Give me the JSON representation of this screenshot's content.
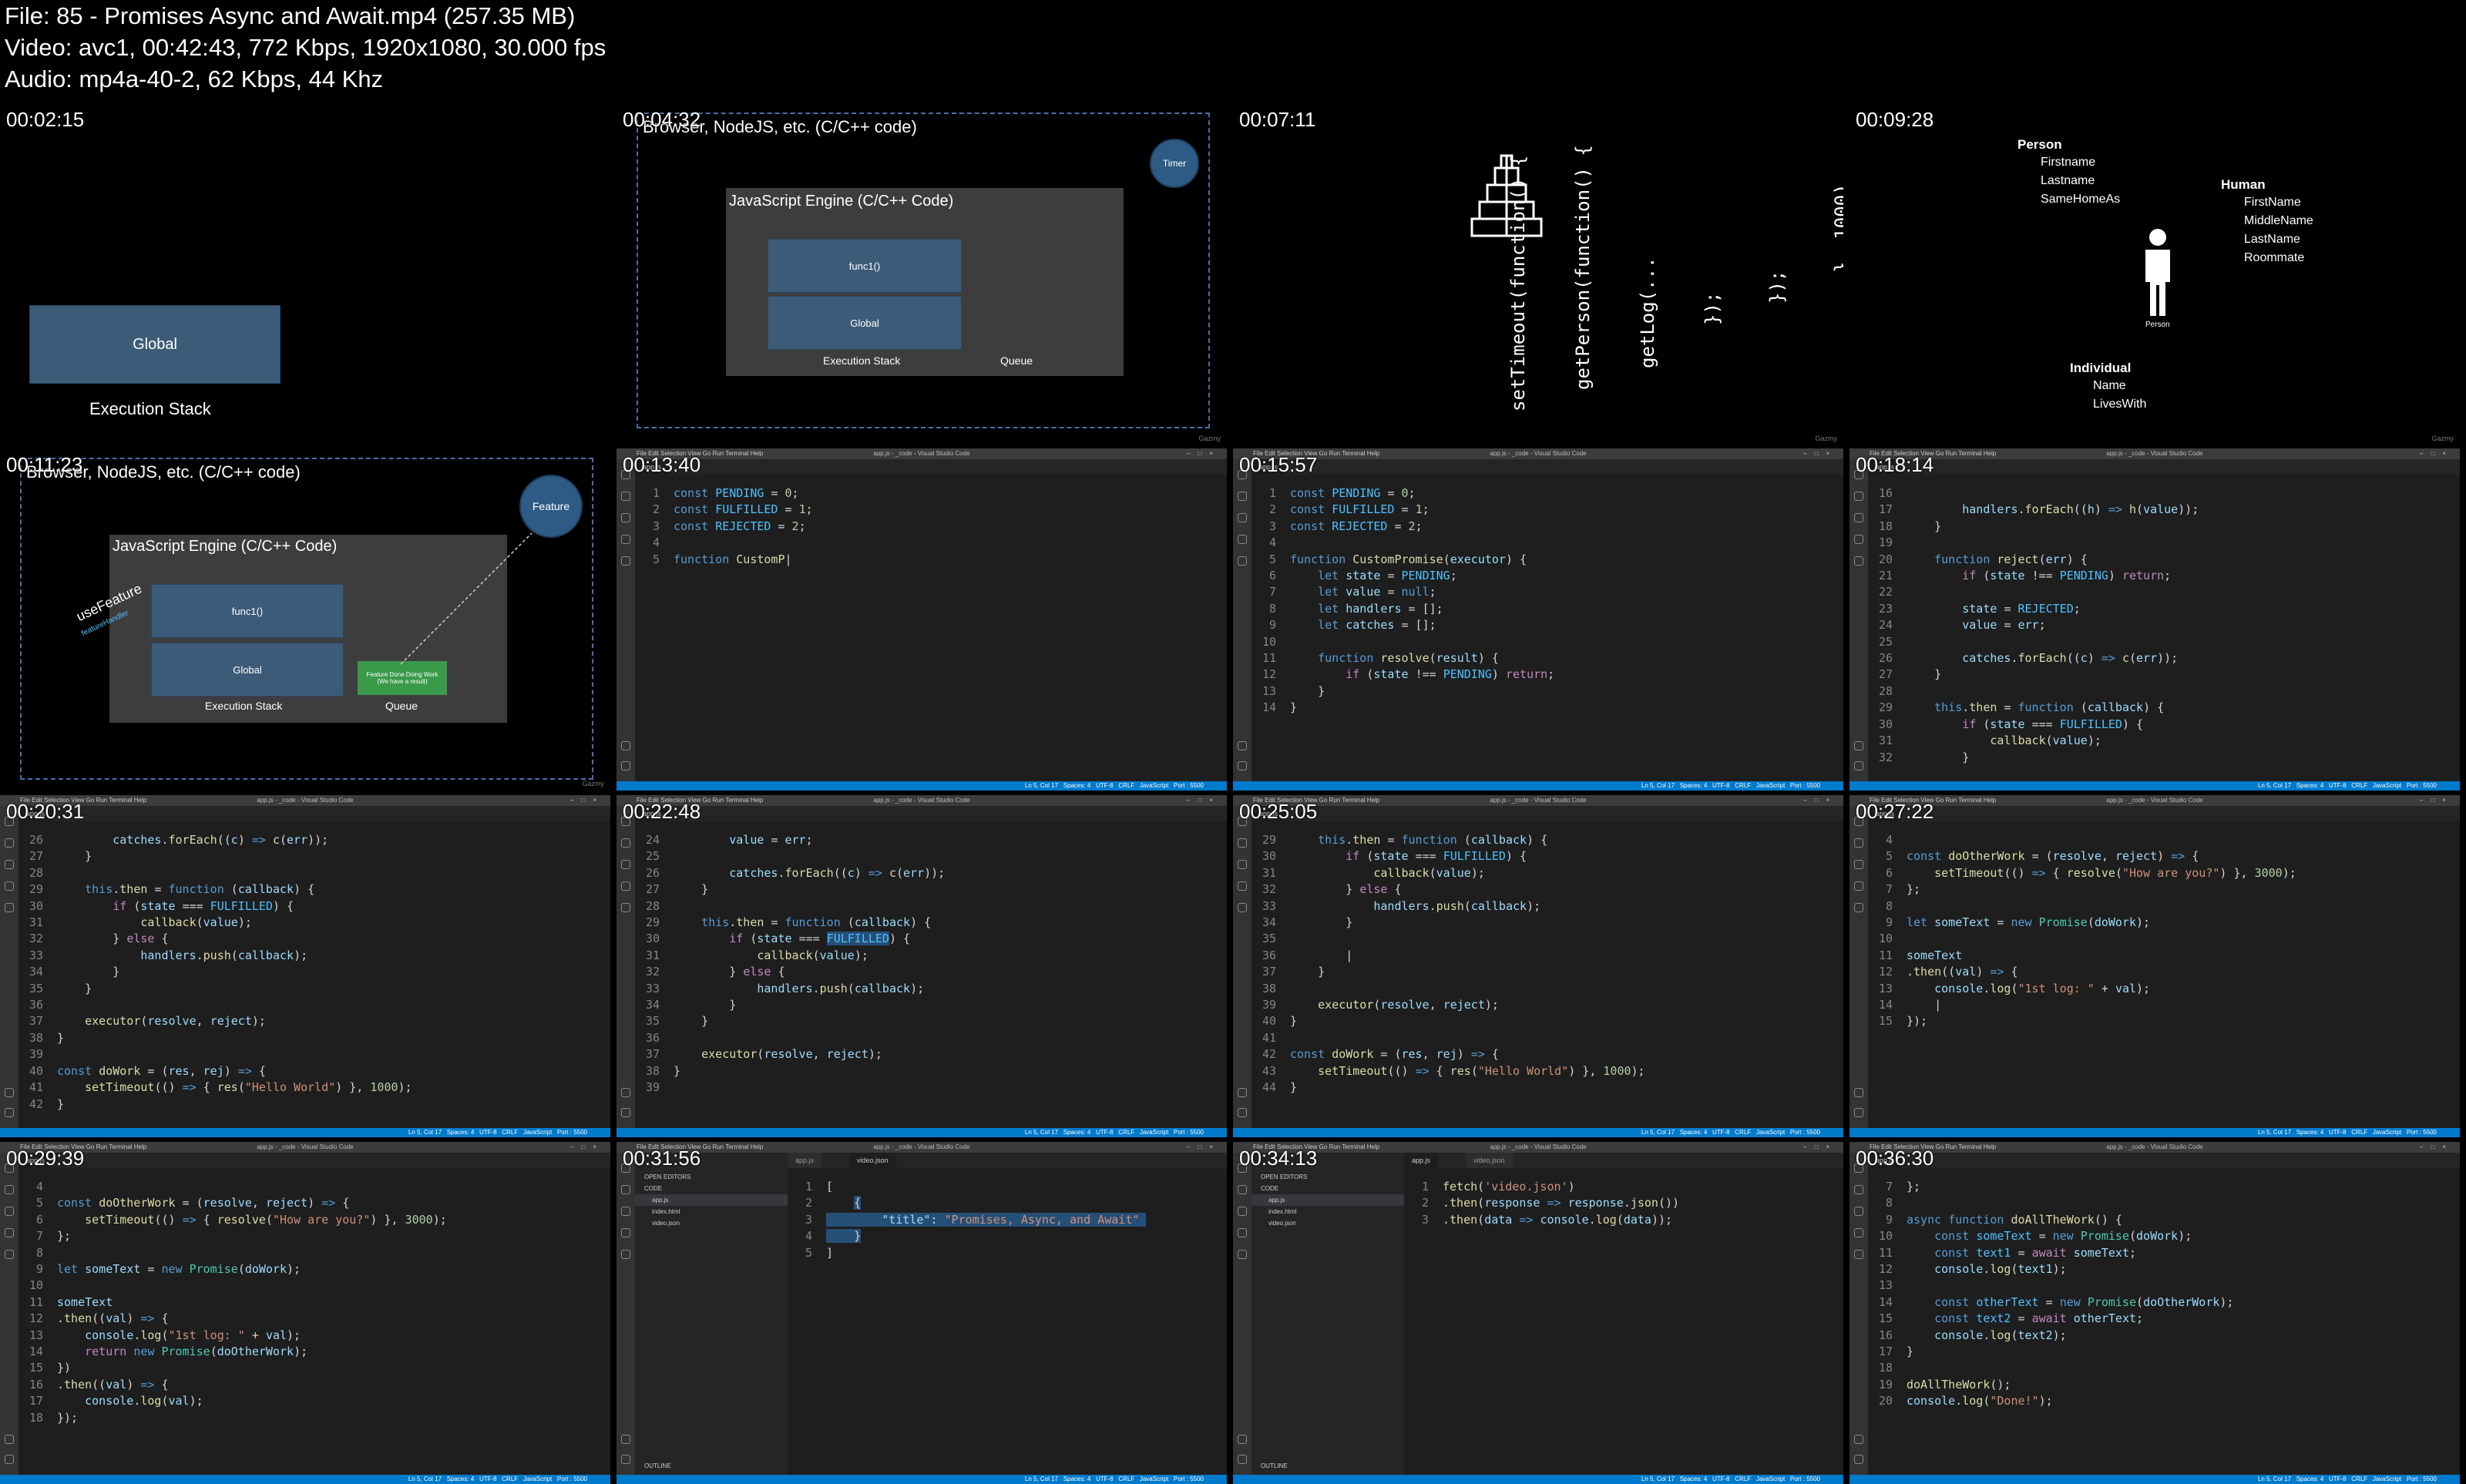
{
  "header": {
    "line1": "File: 85 - Promises Async and Await.mp4 (257.35 MB)",
    "line2": "Video: avc1, 00:42:43, 772 Kbps, 1920x1080, 30.000 fps",
    "line3": "Audio: mp4a-40-2, 62 Kbps, 44 Khz"
  },
  "watermark": "Gazmy",
  "tiles": [
    {
      "time": "00:02:15",
      "global": "Global",
      "stack": "Execution Stack"
    },
    {
      "time": "00:04:32",
      "outer": "Browser, NodeJS, etc. (C/C++ code)",
      "engine": "JavaScript Engine (C/C++ Code)",
      "func1": "func1()",
      "global": "Global",
      "stack": "Execution Stack",
      "queue": "Queue",
      "timer": "Timer"
    },
    {
      "time": "00:07:11",
      "lines": [
        "setTimeout(function() {",
        "getPerson(function() {",
        "getLog(...",
        "});",
        "});",
        "}, 1000)"
      ]
    },
    {
      "time": "00:09:28",
      "person_title": "Person",
      "person_props": [
        "Firstname",
        "Lastname",
        "SameHomeAs"
      ],
      "human_title": "Human",
      "human_props": [
        "FirstName",
        "MiddleName",
        "LastName",
        "Roommate"
      ],
      "figure_label": "Person",
      "indiv_title": "Individual",
      "indiv_props": [
        "Name",
        "LivesWith"
      ]
    },
    {
      "time": "00:11:23",
      "outer": "Browser, NodeJS, etc. (C/C++ code)",
      "engine": "JavaScript Engine (C/C++ Code)",
      "func1": "func1()",
      "global": "Global",
      "stack": "Execution Stack",
      "queue": "Queue",
      "feature": "Feature",
      "use_feature": "useFeature",
      "feature_handler": "featureHandler",
      "done": "Feature Done Doing Work (We have a result)"
    },
    {
      "time": "00:13:40"
    },
    {
      "time": "00:15:57"
    },
    {
      "time": "00:18:14"
    },
    {
      "time": "00:20:31"
    },
    {
      "time": "00:22:48"
    },
    {
      "time": "00:25:05"
    },
    {
      "time": "00:27:22"
    },
    {
      "time": "00:29:39"
    },
    {
      "time": "00:31:56"
    },
    {
      "time": "00:34:13"
    },
    {
      "time": "00:36:30"
    }
  ],
  "vscode": {
    "menu": "File  Edit  Selection  View  Go  Run  Terminal  Help",
    "title": "app.js - _code - Visual Studio Code",
    "tab_app": "app.js",
    "tab_video": "video.json",
    "tab_index": "index.html",
    "status": "Ln 5, Col 17   Spaces: 4   UTF-8   CRLF   JavaScript   Port : 5500",
    "open_editors": "OPEN EDITORS",
    "folder": "CODE",
    "outline": "OUTLINE"
  }
}
